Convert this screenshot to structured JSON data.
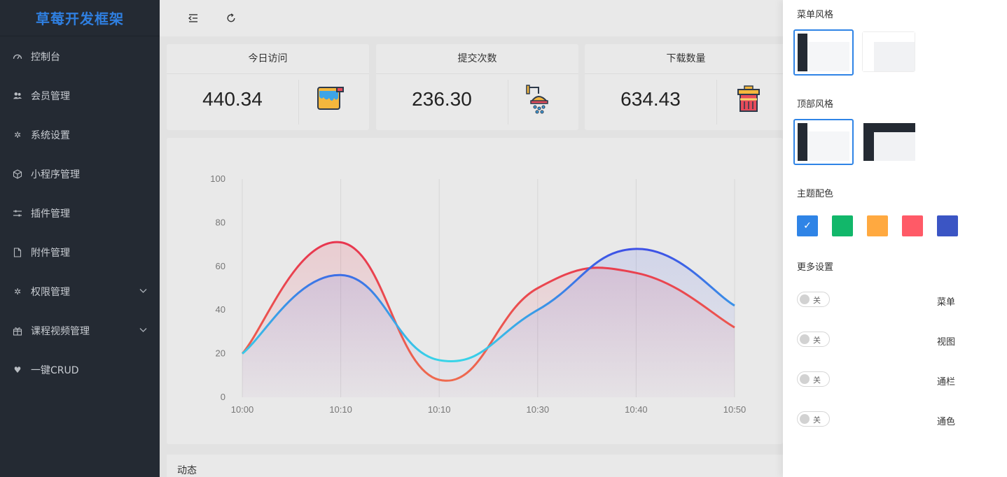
{
  "app": {
    "title": "草莓开发框架"
  },
  "sidebar": {
    "items": [
      {
        "label": "控制台",
        "icon": "dashboard-icon"
      },
      {
        "label": "会员管理",
        "icon": "users-icon"
      },
      {
        "label": "系统设置",
        "icon": "gear-icon"
      },
      {
        "label": "小程序管理",
        "icon": "cube-icon"
      },
      {
        "label": "插件管理",
        "icon": "sliders-icon"
      },
      {
        "label": "附件管理",
        "icon": "file-icon"
      },
      {
        "label": "权限管理",
        "icon": "gear-icon",
        "expandable": true
      },
      {
        "label": "课程视频管理",
        "icon": "gift-icon",
        "expandable": true
      },
      {
        "label": "一键CRUD",
        "icon": "heart-icon"
      }
    ]
  },
  "toolbar": {
    "collapse_icon": "indent-icon",
    "refresh_icon": "refresh-icon"
  },
  "stats": [
    {
      "title": "今日访问",
      "value": "440.34",
      "icon": "paint-bucket-icon"
    },
    {
      "title": "提交次数",
      "value": "236.30",
      "icon": "shower-icon"
    },
    {
      "title": "下载数量",
      "value": "634.43",
      "icon": "trash-icon"
    }
  ],
  "chart_data": {
    "type": "line",
    "x": [
      "10:00",
      "10:10",
      "10:10",
      "10:30",
      "10:40",
      "10:50"
    ],
    "ylim": [
      0,
      100
    ],
    "yticks": [
      "0",
      "20",
      "40",
      "60",
      "80",
      "100"
    ],
    "grid": "vertical",
    "series": [
      {
        "values": [
          20,
          71,
          8,
          50,
          57,
          32
        ],
        "color": "#e8364f"
      },
      {
        "values": [
          20,
          56,
          17,
          40,
          68,
          42
        ],
        "color": "#3d8fe6"
      }
    ]
  },
  "activity": {
    "title": "动态"
  },
  "settings": {
    "menu_style_title": "菜单风格",
    "top_style_title": "顶部风格",
    "theme_title": "主题配色",
    "theme_colors": [
      "#2f84e6",
      "#12b76a",
      "#ffa940",
      "#ff5a67",
      "#3b55c4"
    ],
    "more_title": "更多设置",
    "toggles": [
      {
        "state": "关",
        "label": "菜单"
      },
      {
        "state": "关",
        "label": "视图"
      },
      {
        "state": "关",
        "label": "通栏"
      },
      {
        "state": "关",
        "label": "通色"
      }
    ]
  }
}
